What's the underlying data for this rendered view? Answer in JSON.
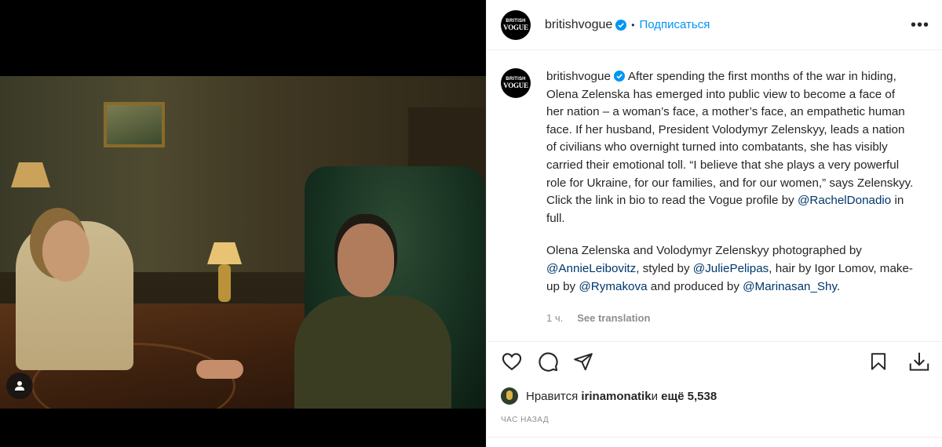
{
  "post": {
    "username": "britishvogue",
    "avatar_line1": "BRITISH",
    "avatar_line2": "VOGUE",
    "dot": "•",
    "follow_label": "Подписаться",
    "more_label": "•••",
    "verified_icon": "verified-badge-icon",
    "accent_color": "#0095f6"
  },
  "caption": {
    "username": "britishvogue",
    "p1_text": "After spending the first months of the war in hiding, Olena Zelenska has emerged into public view to become a face of her nation – a woman’s face, a mother’s face, an empathetic human face. If her husband, President Volodymyr Zelenskyy, leads a nation of civilians who overnight turned into combatants, she has visibly carried their emotional toll. “I believe that she plays a very powerful role for Ukraine, for our families, and for our women,” says Zelenskyy. Click the link in bio to read the Vogue profile by ",
    "p1_mention": "@RachelDonadio",
    "p1_end": " in full.",
    "p2_a": "Olena Zelenska and Volodymyr Zelenskyy photographed by ",
    "p2_m1": "@AnnieLeibovitz",
    "p2_b": ", styled by ",
    "p2_m2": "@JuliePelipas",
    "p2_c": ", hair by Igor Lomov, make-up by ",
    "p2_m3": "@Rymakova",
    "p2_d": " and produced by ",
    "p2_m4": "@Marinasan_Shy",
    "p2_e": ".",
    "age": "1 ч.",
    "see_translation": "See translation"
  },
  "actions": {
    "like_icon": "heart-icon",
    "comment_icon": "comment-icon",
    "share_icon": "send-icon",
    "save_icon": "bookmark-icon",
    "download_icon": "download-icon"
  },
  "likes": {
    "prefix": "Нравится ",
    "user": "irinamonatik",
    "middle": " и ",
    "count": "ещё 5,538"
  },
  "timestamp": "ЧАС НАЗАД"
}
